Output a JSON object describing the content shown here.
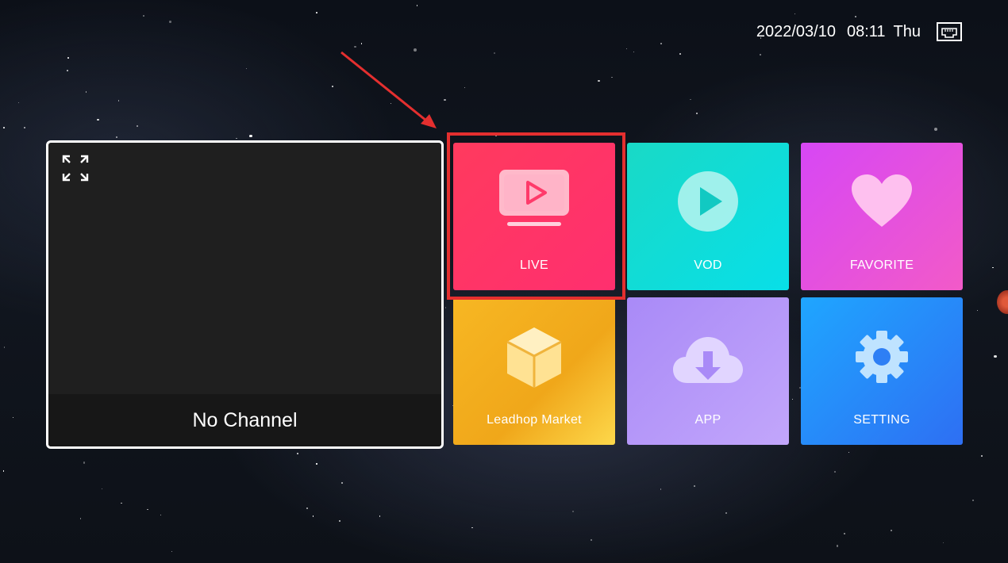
{
  "status": {
    "date": "2022/03/10",
    "time": "08:11",
    "weekday": "Thu",
    "network_icon": "ethernet-icon"
  },
  "preview": {
    "caption": "No Channel",
    "fullscreen_icon": "fullscreen-icon"
  },
  "tiles": [
    {
      "id": "live",
      "label": "LIVE",
      "icon": "tv-play-icon",
      "focused": true
    },
    {
      "id": "vod",
      "label": "VOD",
      "icon": "play-circle-icon"
    },
    {
      "id": "favorite",
      "label": "FAVORITE",
      "icon": "heart-icon"
    },
    {
      "id": "market",
      "label": "Leadhop Market",
      "icon": "box-icon"
    },
    {
      "id": "app",
      "label": "APP",
      "icon": "cloud-download-icon"
    },
    {
      "id": "setting",
      "label": "SETTING",
      "icon": "gear-icon"
    }
  ],
  "colors": {
    "live": "#ff3a5e",
    "vod": "#08dfe8",
    "favorite": "#e44fe0",
    "market": "#f7b723",
    "app": "#b59af9",
    "setting": "#2a8bf7",
    "focus_frame": "#e42f2f"
  }
}
